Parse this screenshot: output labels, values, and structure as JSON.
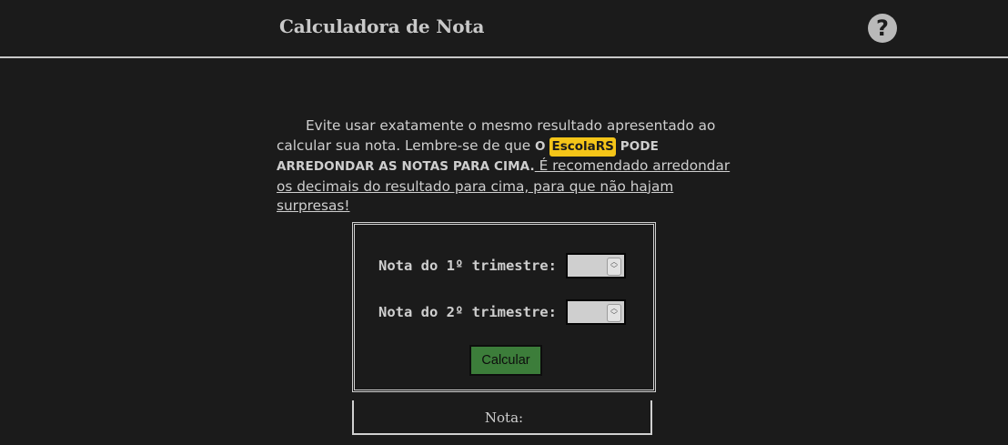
{
  "header": {
    "title": "Calculadora de Nota",
    "help_icon": "question-circle-icon",
    "help_glyph": "?"
  },
  "notice": {
    "part1": "Evite usar exatamente o mesmo resultado apresentado ao calcular sua nota. Lembre-se de que ",
    "bold_prefix": "O",
    "badge": "EscolaRS",
    "bold_suffix": "PODE ARREDONDAR AS NOTAS PARA CIMA.",
    "underline": " É recomendado arredondar os decimais do resultado para cima, para que não hajam surpresas!",
    "badge_color": "#f5c518"
  },
  "form": {
    "field1_label": "Nota do 1º trimestre:",
    "field1_value": "",
    "field2_label": "Nota do 2º trimestre:",
    "field2_value": "",
    "submit_label": "Calcular",
    "submit_color": "#3c7d3a"
  },
  "result": {
    "label": "Nota:"
  }
}
